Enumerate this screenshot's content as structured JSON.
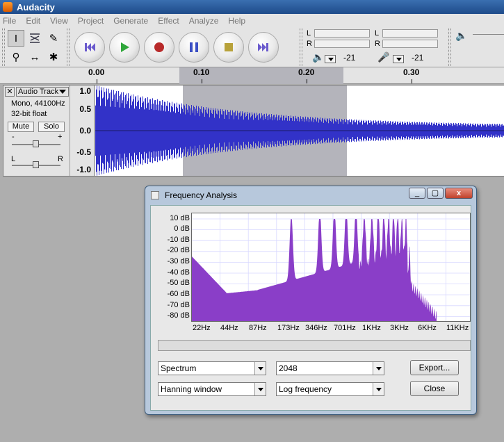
{
  "window": {
    "title": "Audacity",
    "icon": "audacity-icon"
  },
  "menu": [
    "File",
    "Edit",
    "View",
    "Project",
    "Generate",
    "Effect",
    "Analyze",
    "Help"
  ],
  "tools": [
    "selection-tool-icon",
    "envelope-tool-icon",
    "draw-tool-icon",
    "zoom-tool-icon",
    "timeshift-tool-icon",
    "multi-tool-icon"
  ],
  "transport": {
    "buttons": [
      "skip-start-icon",
      "play-icon",
      "record-icon",
      "pause-icon",
      "stop-icon",
      "skip-end-icon"
    ],
    "colors": {
      "skip": "#6a5acd",
      "play": "#2fa63a",
      "record": "#b82a2a",
      "pause": "#3b4fc4",
      "stop": "#b8a23a"
    }
  },
  "meters": {
    "output": {
      "l": "L",
      "r": "R",
      "value": "-21"
    },
    "input": {
      "l": "L",
      "r": "R",
      "value": "-21"
    }
  },
  "ruler": {
    "ticks": [
      "0.00",
      "0.10",
      "0.20",
      "0.30"
    ]
  },
  "track": {
    "name": "Audio Track",
    "info1": "Mono, 44100Hz",
    "info2": "32-bit float",
    "mute": "Mute",
    "solo": "Solo",
    "gain_minus": "-",
    "gain_plus": "+",
    "pan_left": "L",
    "pan_right": "R",
    "scale": [
      "1.0",
      "0.5",
      "0.0",
      "-0.5",
      "-1.0"
    ],
    "wave_color": "#3232c8"
  },
  "dialog": {
    "title": "Frequency Analysis",
    "min_label": "_",
    "max_label": "▢",
    "close_label": "x",
    "y_ticks": [
      "10 dB",
      "0 dB",
      "-10 dB",
      "-20 dB",
      "-30 dB",
      "-40 dB",
      "-50 dB",
      "-60 dB",
      "-70 dB",
      "-80 dB"
    ],
    "x_ticks": [
      "22Hz",
      "44Hz",
      "87Hz",
      "173Hz",
      "346Hz",
      "701Hz",
      "1KHz",
      "3KHz",
      "6KHz",
      "11KHz"
    ],
    "fill_color": "#8a3ec8",
    "algorithm": "Spectrum",
    "size": "2048",
    "window_func": "Hanning window",
    "axis": "Log frequency",
    "export": "Export...",
    "close": "Close"
  }
}
